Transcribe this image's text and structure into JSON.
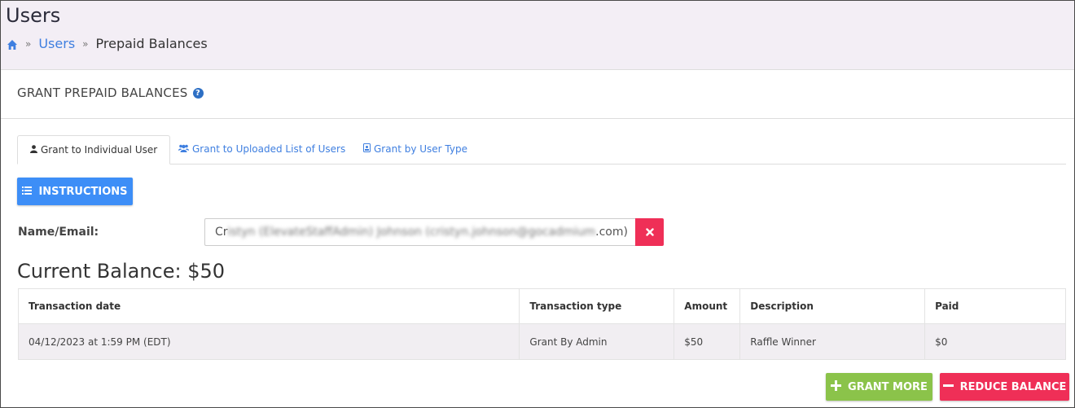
{
  "header": {
    "title": "Users",
    "breadcrumb": {
      "home_icon": "home-icon",
      "separator": "»",
      "link": "Users",
      "current": "Prepaid Balances"
    }
  },
  "section": {
    "title": "GRANT PREPAID BALANCES",
    "help_icon": "question-circle-icon"
  },
  "tabs": [
    {
      "label": "Grant to Individual User",
      "icon": "user-icon",
      "active": true
    },
    {
      "label": "Grant to Uploaded List of Users",
      "icon": "users-icon",
      "active": false
    },
    {
      "label": "Grant by User Type",
      "icon": "id-badge-icon",
      "active": false
    }
  ],
  "instructions_button": {
    "label": "INSTRUCTIONS",
    "icon": "list-icon"
  },
  "form": {
    "name_label": "Name/Email:",
    "value_start": "Cr",
    "value_blurred": "istyn (ElevateStaffAdmin) Johnson (cristyn.johnson@gocadmium",
    "value_end": ".com)",
    "clear_icon": "times-icon"
  },
  "balance": {
    "text": "Current Balance: $50"
  },
  "table": {
    "headers": [
      "Transaction date",
      "Transaction type",
      "Amount",
      "Description",
      "Paid"
    ],
    "rows": [
      [
        "04/12/2023 at 1:59 PM (EDT)",
        "Grant By Admin",
        "$50",
        "Raffle Winner",
        "$0"
      ]
    ]
  },
  "actions": {
    "grant_more": "GRANT MORE",
    "reduce_balance": "REDUCE BALANCE",
    "grant_color": "#8bc34a",
    "reduce_color": "#ef2f57"
  },
  "colors": {
    "accent": "#3d8ef7",
    "link": "#3f7fe0",
    "header_bg": "#f3eef5"
  }
}
